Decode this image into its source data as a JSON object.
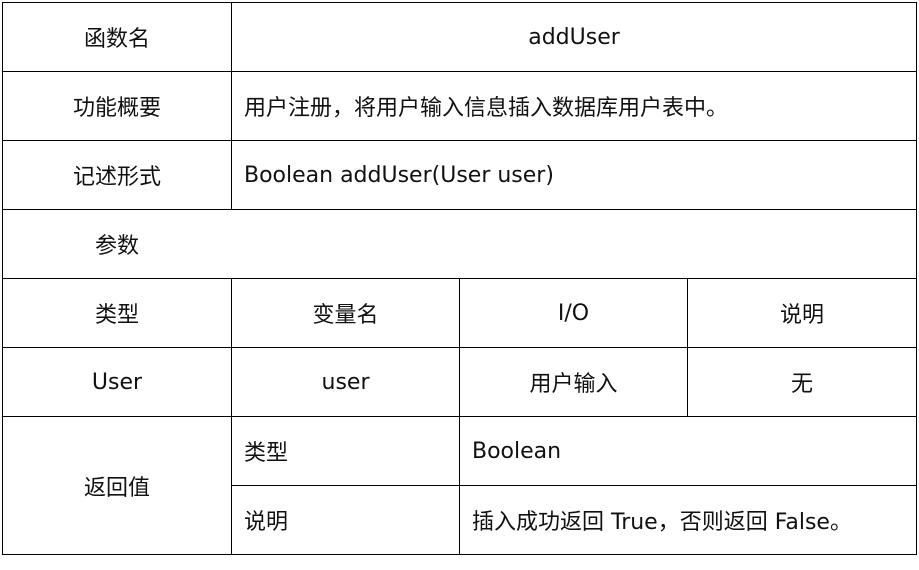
{
  "rows": {
    "function_name": {
      "label": "函数名",
      "value": "addUser"
    },
    "summary": {
      "label": "功能概要",
      "value": "用户注册，将用户输入信息插入数据库用户表中。"
    },
    "signature": {
      "label": "记述形式",
      "value": "Boolean addUser(User user)"
    },
    "params_title": "参数",
    "params_headers": [
      "类型",
      "变量名",
      "I/O",
      "说明"
    ],
    "params_rows": [
      [
        "User",
        "user",
        "用户输入",
        "无"
      ]
    ],
    "return_value": {
      "label": "返回值",
      "type_label": "类型",
      "type_value": "Boolean",
      "desc_label": "说明",
      "desc_value": "插入成功返回 True，否则返回 False。"
    }
  }
}
